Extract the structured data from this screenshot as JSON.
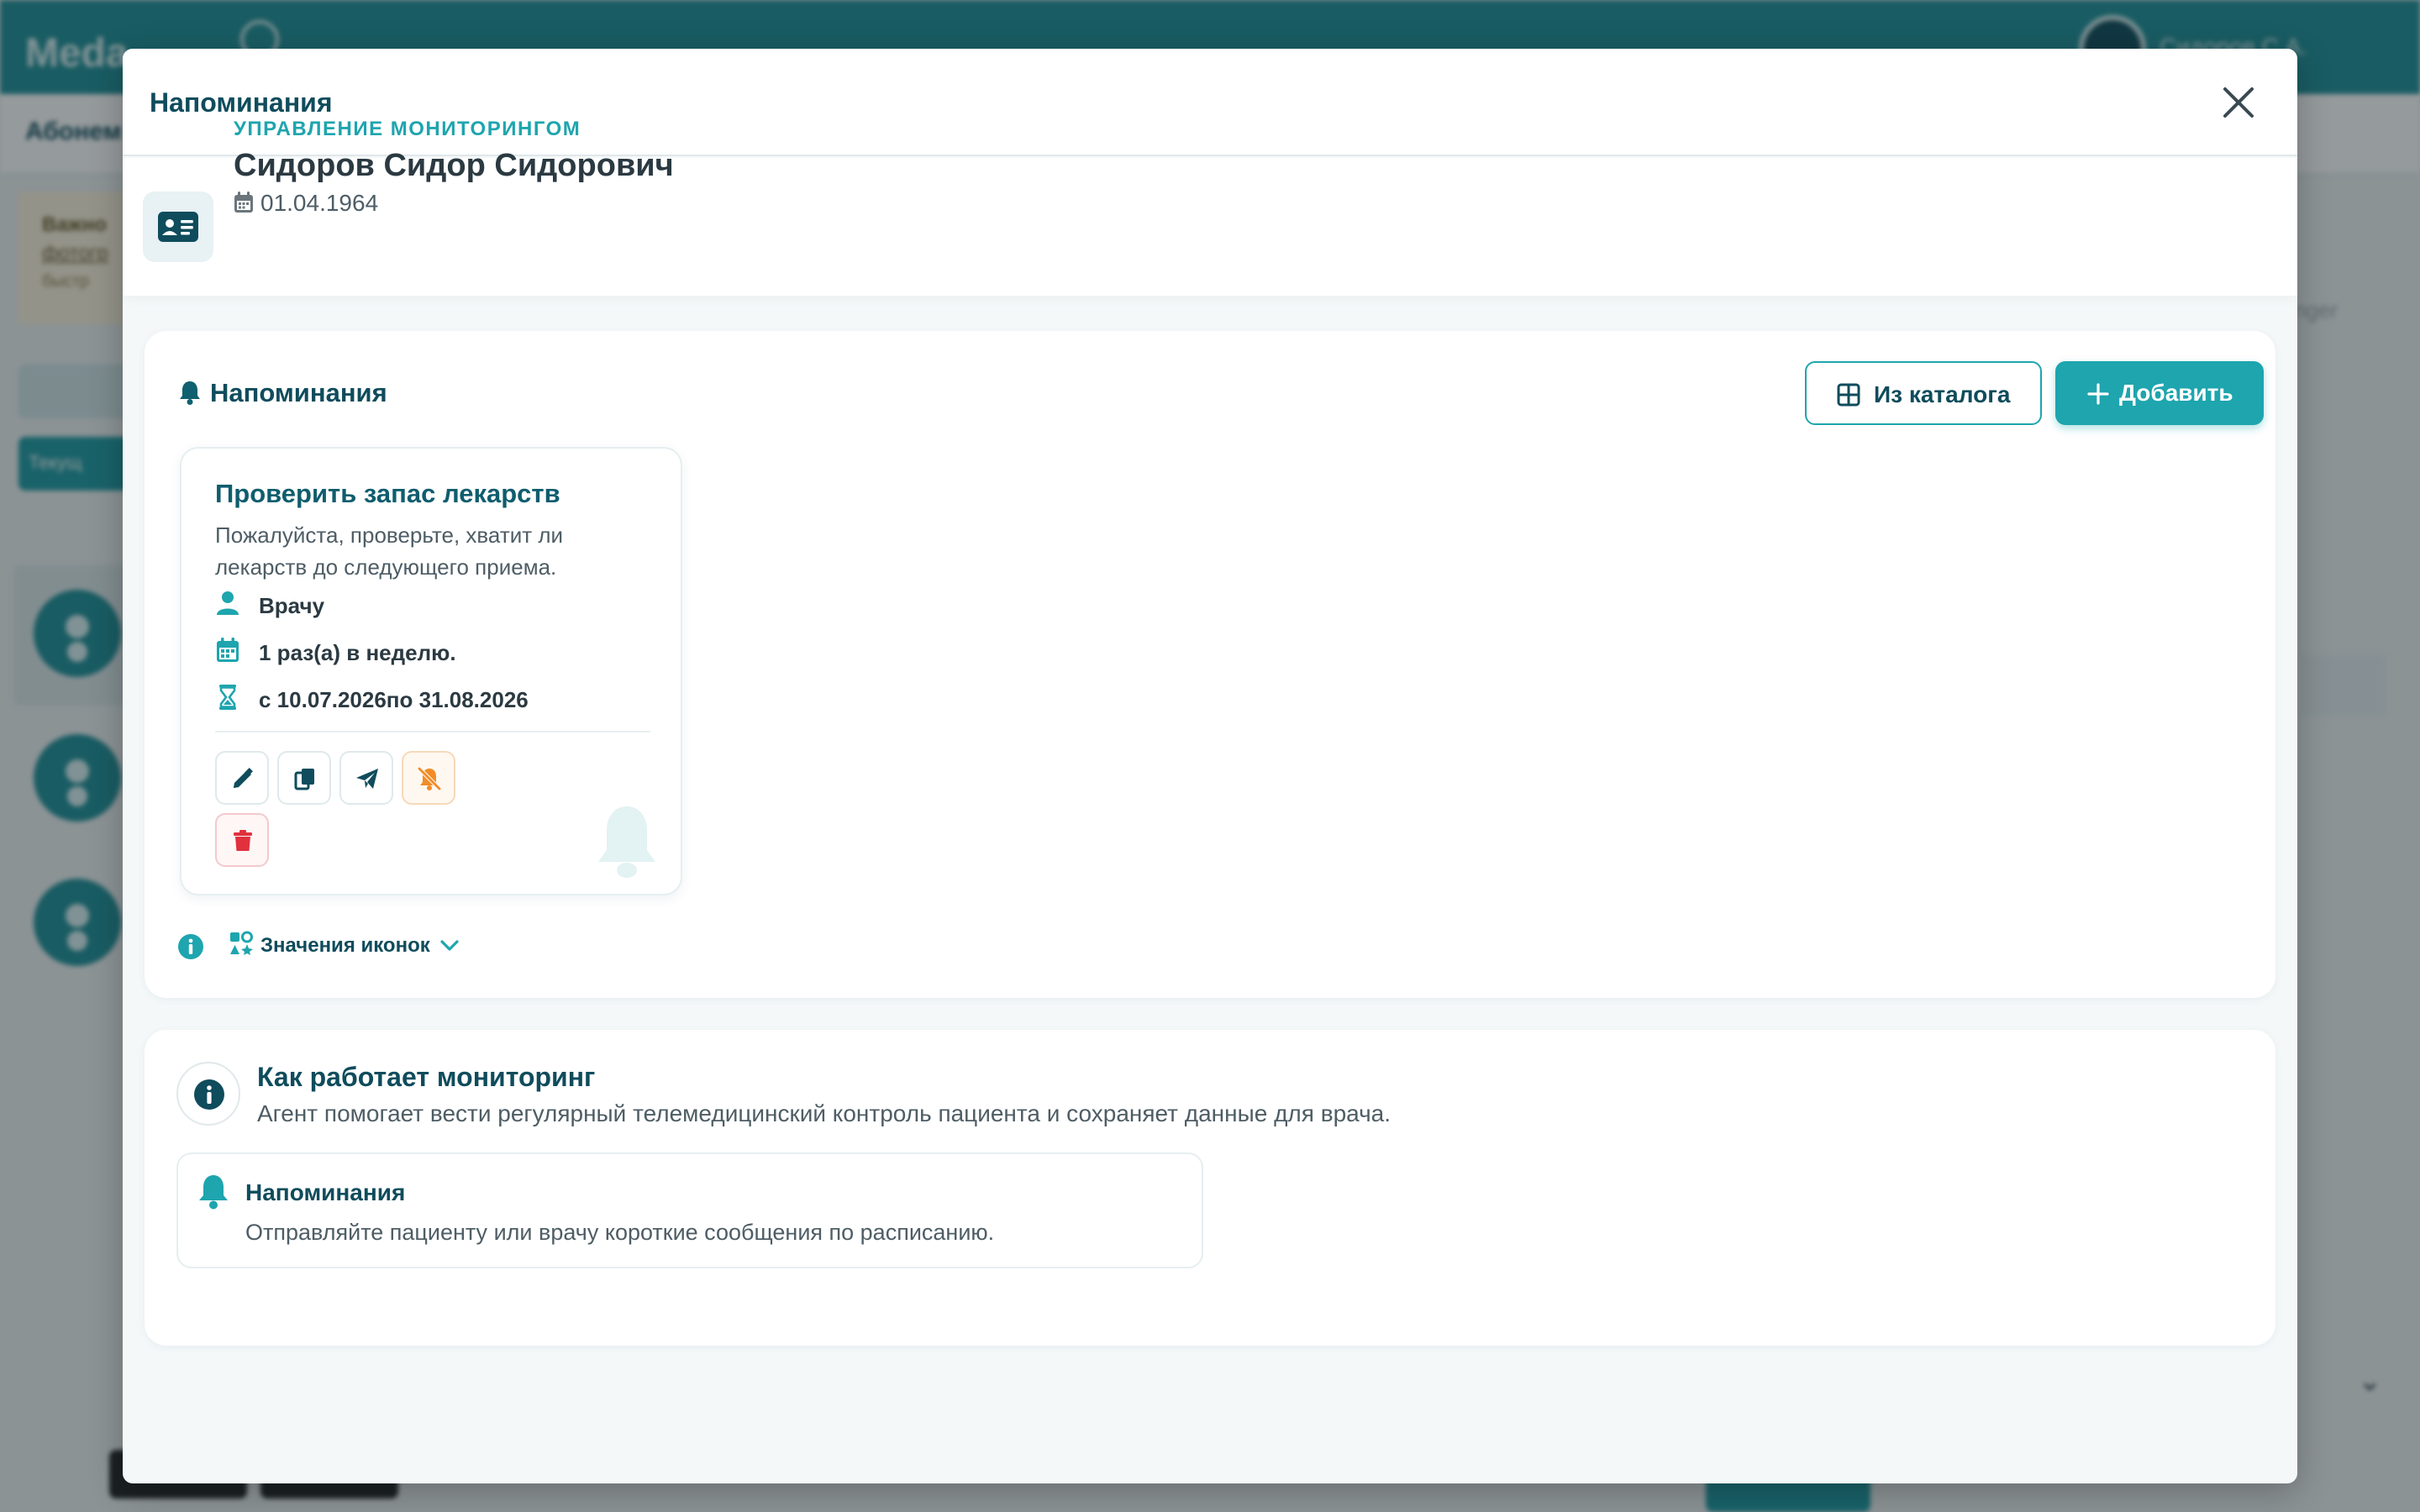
{
  "background": {
    "brand": "Meda",
    "user_name": "Сидоров С.А.",
    "subbar_label": "Абонем",
    "warning": {
      "line1": "Важно",
      "line2": "фотогр",
      "line3": "быстр"
    },
    "tab_label": "Текущ",
    "right_text": "nger"
  },
  "modal": {
    "title": "Напоминания",
    "close_icon": "close-icon"
  },
  "patient": {
    "kicker": "УПРАВЛЕНИЕ МОНИТОРИНГОМ",
    "name": "Сидоров Сидор Сидорович",
    "dob": "01.04.1964"
  },
  "reminders": {
    "title": "Напоминания",
    "catalog_button": "Из каталога",
    "add_button": "Добавить",
    "items": [
      {
        "title": "Проверить запас лекарств",
        "description": "Пожалуйста, проверьте, хватит ли лекарств до следующего приема.",
        "recipient": "Врачу",
        "frequency": "1 раз(а) в неделю.",
        "period": "с 10.07.2026по 31.08.2026"
      }
    ],
    "legend_label": "Значения иконок"
  },
  "how_it_works": {
    "title": "Как работает мониторинг",
    "description": "Агент помогает вести регулярный телемедицинский контроль пациента и сохраняет данные для врача.",
    "item": {
      "title": "Напоминания",
      "description": "Отправляйте пациенту или врачу короткие сообщения по расписанию."
    }
  },
  "colors": {
    "primary": "#1ea5ae",
    "dark": "#0f4c5c",
    "warning": "#f28c28",
    "danger": "#e0313d"
  }
}
